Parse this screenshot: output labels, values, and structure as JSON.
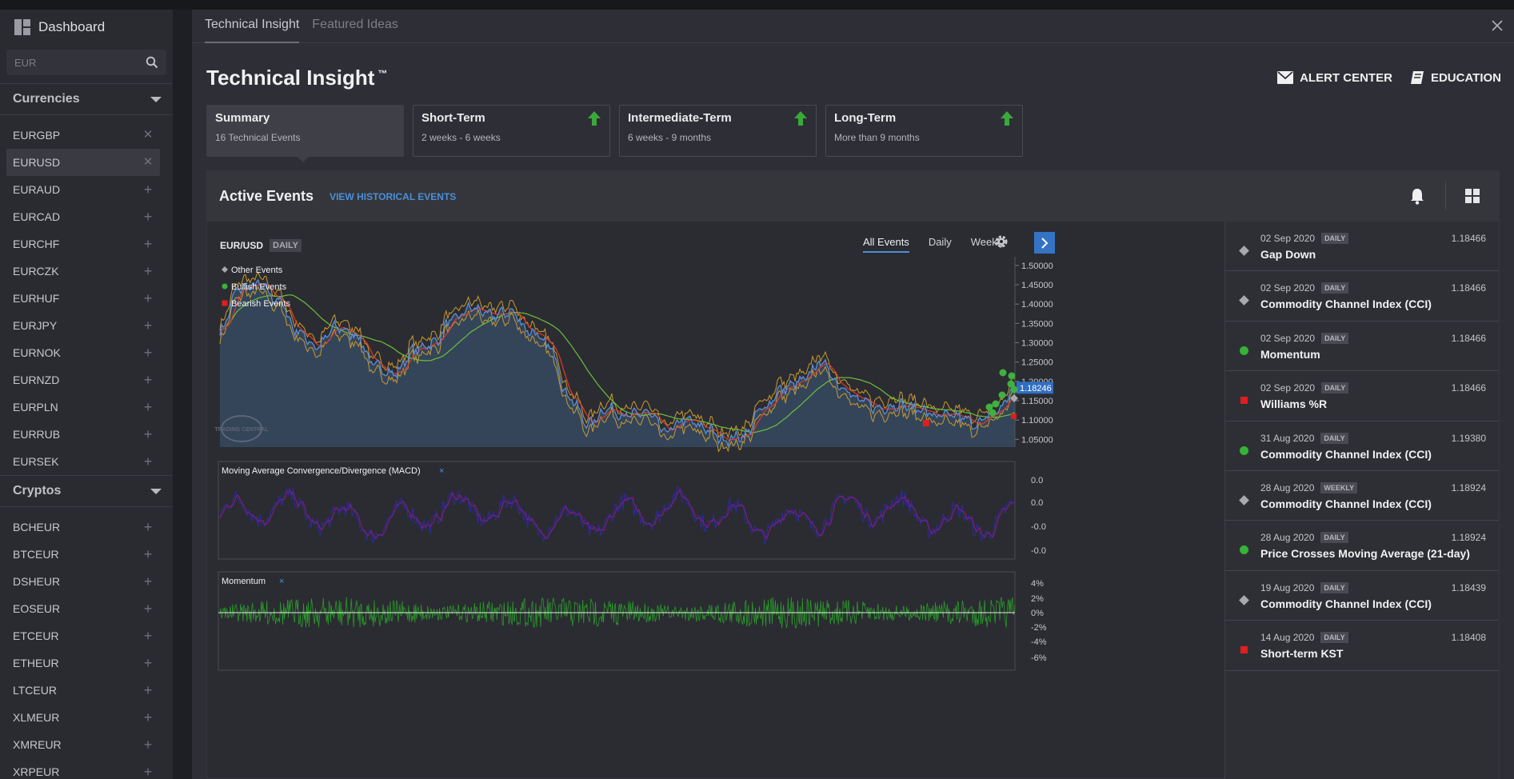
{
  "sidebar": {
    "dashboard_label": "Dashboard",
    "search_placeholder": "EUR",
    "sections": [
      {
        "title": "Currencies",
        "items": [
          "EURGBP",
          "EURUSD",
          "EURAUD",
          "EURCAD",
          "EURCHF",
          "EURCZK",
          "EURHUF",
          "EURJPY",
          "EURNOK",
          "EURNZD",
          "EURPLN",
          "EURRUB",
          "EURSEK"
        ]
      },
      {
        "title": "Cryptos",
        "items": [
          "BCHEUR",
          "BTCEUR",
          "DSHEUR",
          "EOSEUR",
          "ETCEUR",
          "ETHEUR",
          "LTCEUR",
          "XLMEUR",
          "XMREUR",
          "XRPEUR"
        ]
      }
    ],
    "selected_item": "EURUSD",
    "removable_items": [
      "EURGBP",
      "EURUSD"
    ]
  },
  "tabs": [
    "Technical Insight",
    "Featured Ideas"
  ],
  "page": {
    "title": "Technical Insight",
    "trademark": "™",
    "alert_center": "ALERT CENTER",
    "education": "EDUCATION"
  },
  "cards": [
    {
      "title": "Summary",
      "sub": "16 Technical Events",
      "arrow": false
    },
    {
      "title": "Short-Term",
      "sub": "2 weeks - 6 weeks",
      "arrow": true
    },
    {
      "title": "Intermediate-Term",
      "sub": "6 weeks - 9 months",
      "arrow": true
    },
    {
      "title": "Long-Term",
      "sub": "More than 9 months",
      "arrow": true
    }
  ],
  "active_events": {
    "title": "Active Events",
    "view_historical": "VIEW HISTORICAL EVENTS"
  },
  "chart": {
    "symbol": "EUR/USD",
    "interval": "DAILY",
    "filter_tabs": [
      "All Events",
      "Daily",
      "Weekly"
    ],
    "active_filter": "All Events",
    "legend": [
      "Other Events",
      "Bullish Events",
      "Bearish Events"
    ],
    "price_ticks": [
      "1.50000",
      "1.45000",
      "1.40000",
      "1.35000",
      "1.30000",
      "1.25000",
      "1.20000",
      "1.15000",
      "1.10000",
      "1.05000"
    ],
    "current_price": "1.18246",
    "macd_label": "Moving Average Convergence/Divergence (MACD)",
    "macd_ticks": [
      "0.0",
      "0.0",
      "-0.0",
      "-0.0"
    ],
    "momentum_label": "Momentum",
    "momentum_ticks": [
      "4%",
      "2%",
      "0%",
      "-2%",
      "-4%",
      "-6%"
    ],
    "watermark": "TRADING CENTRAL",
    "colors": {
      "area": "#34455a",
      "price": "#5b8fd6",
      "ma_fast": "#e03a2a",
      "ma_slow": "#6bc03a",
      "band": "#c99a2e",
      "macd": "#2a2aa8",
      "macd_signal": "#8a1a8a",
      "momentum": "#2a9a2a"
    }
  },
  "chart_data": {
    "type": "line",
    "title": "EUR/USD",
    "ylabel": "",
    "xlabel": "",
    "ylim": [
      1.03,
      1.51
    ],
    "y_ticks": [
      1.5,
      1.45,
      1.4,
      1.35,
      1.3,
      1.25,
      1.2,
      1.15,
      1.1,
      1.05
    ],
    "series": [
      {
        "values": [
          1.33,
          1.44,
          1.45,
          1.41,
          1.33,
          1.29,
          1.34,
          1.32,
          1.24,
          1.22,
          1.28,
          1.3,
          1.36,
          1.39,
          1.37,
          1.38,
          1.33,
          1.29,
          1.16,
          1.09,
          1.13,
          1.11,
          1.12,
          1.07,
          1.1,
          1.08,
          1.05,
          1.06,
          1.13,
          1.18,
          1.2,
          1.25,
          1.19,
          1.15,
          1.13,
          1.14,
          1.13,
          1.11,
          1.11,
          1.09,
          1.12,
          1.18
        ]
      }
    ],
    "legend": "top-left"
  },
  "event_list": [
    {
      "date": "02 Sep 2020",
      "badge": "DAILY",
      "name": "Gap Down",
      "price": "1.18466",
      "kind": "other"
    },
    {
      "date": "02 Sep 2020",
      "badge": "DAILY",
      "name": "Commodity Channel Index (CCI)",
      "price": "1.18466",
      "kind": "other"
    },
    {
      "date": "02 Sep 2020",
      "badge": "DAILY",
      "name": "Momentum",
      "price": "1.18466",
      "kind": "bull"
    },
    {
      "date": "02 Sep 2020",
      "badge": "DAILY",
      "name": "Williams %R",
      "price": "1.18466",
      "kind": "bear"
    },
    {
      "date": "31 Aug 2020",
      "badge": "DAILY",
      "name": "Commodity Channel Index (CCI)",
      "price": "1.19380",
      "kind": "bull"
    },
    {
      "date": "28 Aug 2020",
      "badge": "WEEKLY",
      "name": "Commodity Channel Index (CCI)",
      "price": "1.18924",
      "kind": "other"
    },
    {
      "date": "28 Aug 2020",
      "badge": "DAILY",
      "name": "Price Crosses Moving Average (21-day)",
      "price": "1.18924",
      "kind": "bull"
    },
    {
      "date": "19 Aug 2020",
      "badge": "DAILY",
      "name": "Commodity Channel Index (CCI)",
      "price": "1.18439",
      "kind": "other"
    },
    {
      "date": "14 Aug 2020",
      "badge": "DAILY",
      "name": "Short-term KST",
      "price": "1.18408",
      "kind": "bear"
    }
  ]
}
